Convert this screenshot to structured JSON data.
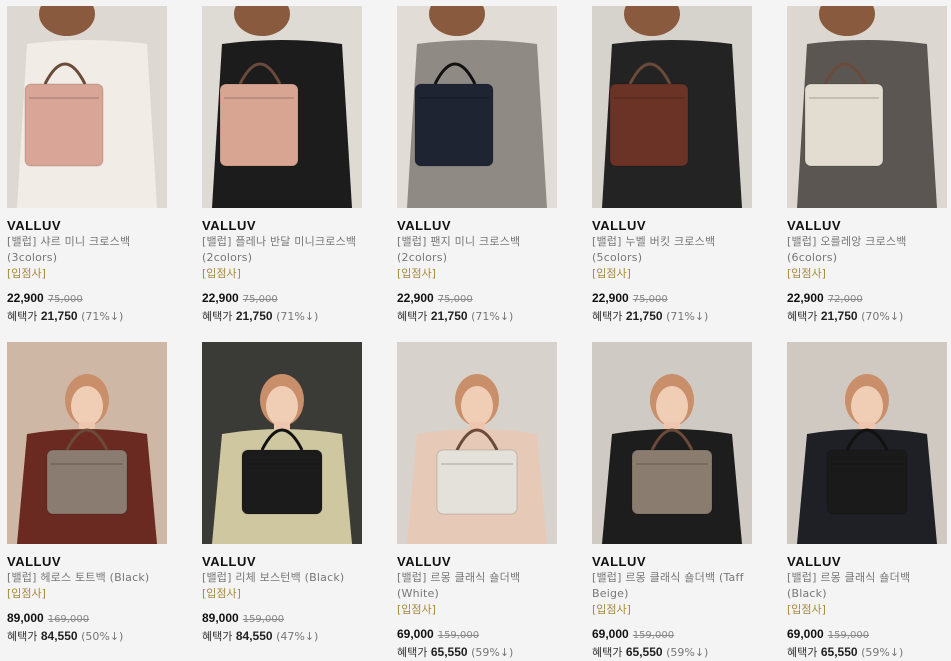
{
  "products": [
    {
      "brand": "VALLUV",
      "name": "[밸럽] 샤르 미니 크로스백 (3colors)",
      "vendor": "[입점사]",
      "price": "22,900",
      "original": "75,000",
      "benefit_label": "혜택가",
      "benefit_price": "21,750",
      "rate": "(71%↓)",
      "bag_color": "#d8a596",
      "bg": "#ddd9d2"
    },
    {
      "brand": "VALLUV",
      "name": "[밸럽] 플레나 반달 미니크로스백 (2colors)",
      "vendor": "[입점사]",
      "price": "22,900",
      "original": "75,000",
      "benefit_label": "혜택가",
      "benefit_price": "21,750",
      "rate": "(71%↓)",
      "bag_color": "#d9a593",
      "bg": "#dedad4"
    },
    {
      "brand": "VALLUV",
      "name": "[밸럽] 팬지 미니 크로스백 (2colors)",
      "vendor": "[입점사]",
      "price": "22,900",
      "original": "75,000",
      "benefit_label": "혜택가",
      "benefit_price": "21,750",
      "rate": "(71%↓)",
      "bag_color": "#1e2432",
      "bg": "#e1ddd6"
    },
    {
      "brand": "VALLUV",
      "name": "[밸럽] 누벨 버킷 크로스백 (5colors)",
      "vendor": "[입점사]",
      "price": "22,900",
      "original": "75,000",
      "benefit_label": "혜택가",
      "benefit_price": "21,750",
      "rate": "(71%↓)",
      "bag_color": "#6b3326",
      "bg": "#d6d3cd"
    },
    {
      "brand": "VALLUV",
      "name": "[밸럽] 오를레앙 크로스백 (6colors)",
      "vendor": "[입점사]",
      "price": "22,900",
      "original": "72,000",
      "benefit_label": "혜택가",
      "benefit_price": "21,750",
      "rate": "(70%↓)",
      "bag_color": "#e2ddd0",
      "bg": "#dcd8d1"
    },
    {
      "brand": "VALLUV",
      "name": "[밸럽] 헤로스 토트백 (Black)",
      "vendor": "[입점사]",
      "price": "89,000",
      "original": "169,000",
      "benefit_label": "혜택가",
      "benefit_price": "84,550",
      "rate": "(50%↓)",
      "bag_color": "#8a7c70",
      "bg": "#cfb7a6"
    },
    {
      "brand": "VALLUV",
      "name": "[밸럽] 리체 보스턴백 (Black)",
      "vendor": "[입점사]",
      "price": "89,000",
      "original": "159,000",
      "benefit_label": "혜택가",
      "benefit_price": "84,550",
      "rate": "(47%↓)",
      "bag_color": "#1b1b1b",
      "bg": "#3a3a36"
    },
    {
      "brand": "VALLUV",
      "name": "[밸럽] 르몽 클래식 숄더백 (White)",
      "vendor": "[입점사]",
      "price": "69,000",
      "original": "159,000",
      "benefit_label": "혜택가",
      "benefit_price": "65,550",
      "rate": "(59%↓)",
      "bag_color": "#e4e1da",
      "bg": "#d7d2cb"
    },
    {
      "brand": "VALLUV",
      "name": "[밸럽] 르몽 클래식 숄더백 (Taff Beige)",
      "vendor": "[입점사]",
      "price": "69,000",
      "original": "159,000",
      "benefit_label": "혜택가",
      "benefit_price": "65,550",
      "rate": "(59%↓)",
      "bag_color": "#8a7d70",
      "bg": "#cfcac4"
    },
    {
      "brand": "VALLUV",
      "name": "[밸럽] 르몽 클래식 숄더백 (Black)",
      "vendor": "[입점사]",
      "price": "69,000",
      "original": "159,000",
      "benefit_label": "혜택가",
      "benefit_price": "65,550",
      "rate": "(59%↓)",
      "bag_color": "#1a1a1a",
      "bg": "#cfc9c2"
    }
  ]
}
